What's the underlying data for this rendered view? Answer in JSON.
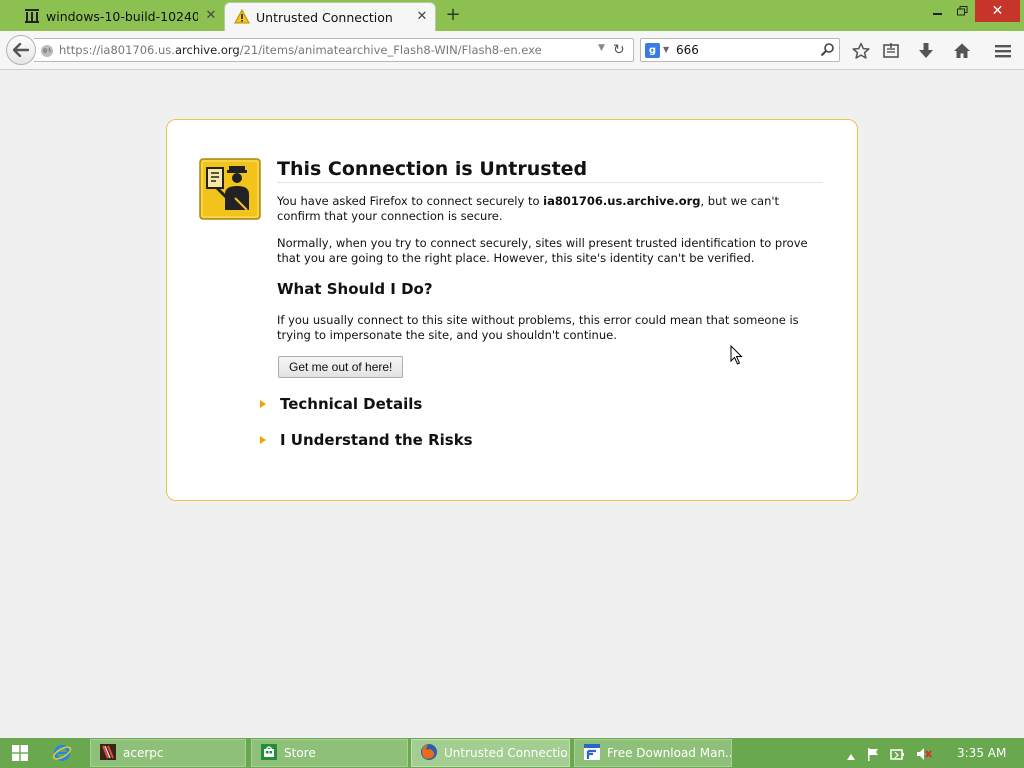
{
  "browser": {
    "tabs": [
      {
        "label": "windows-10-build-10240-3...",
        "icon": "archive-icon",
        "active": false
      },
      {
        "label": "Untrusted Connection",
        "icon": "warning-icon",
        "active": true
      }
    ],
    "url": {
      "prefix": "https://ia801706.us.",
      "domain": "archive.org",
      "suffix": "/21/items/animatearchive_Flash8-WIN/Flash8-en.exe"
    },
    "search": {
      "engine": "Google",
      "engine_letter": "g",
      "value": "666"
    },
    "accent": "#8cc152"
  },
  "error_page": {
    "title": "This Connection is Untrusted",
    "p1_before": "You have asked Firefox to connect securely to ",
    "p1_host": "ia801706.us.archive.org",
    "p1_after": ", but we can't confirm that your connection is secure.",
    "p2": "Normally, when you try to connect securely, sites will present trusted identification to prove that you are going to the right place. However, this site's identity can't be verified.",
    "what_heading": "What Should I Do?",
    "p3": "If you usually connect to this site without problems, this error could mean that someone is trying to impersonate the site, and you shouldn't continue.",
    "escape_button": "Get me out of here!",
    "technical_details": "Technical Details",
    "understand_risks": "I Understand the Risks",
    "border_color": "#f2c24e"
  },
  "taskbar": {
    "items": [
      {
        "label": "acerpc",
        "icon": "user-folder-icon"
      },
      {
        "label": "Store",
        "icon": "store-icon"
      },
      {
        "label": "Untrusted Connectio...",
        "icon": "firefox-icon"
      },
      {
        "label": "Free Download Man...",
        "icon": "fdm-icon"
      }
    ],
    "clock": "3:35 AM",
    "color": "#6aa84f"
  }
}
